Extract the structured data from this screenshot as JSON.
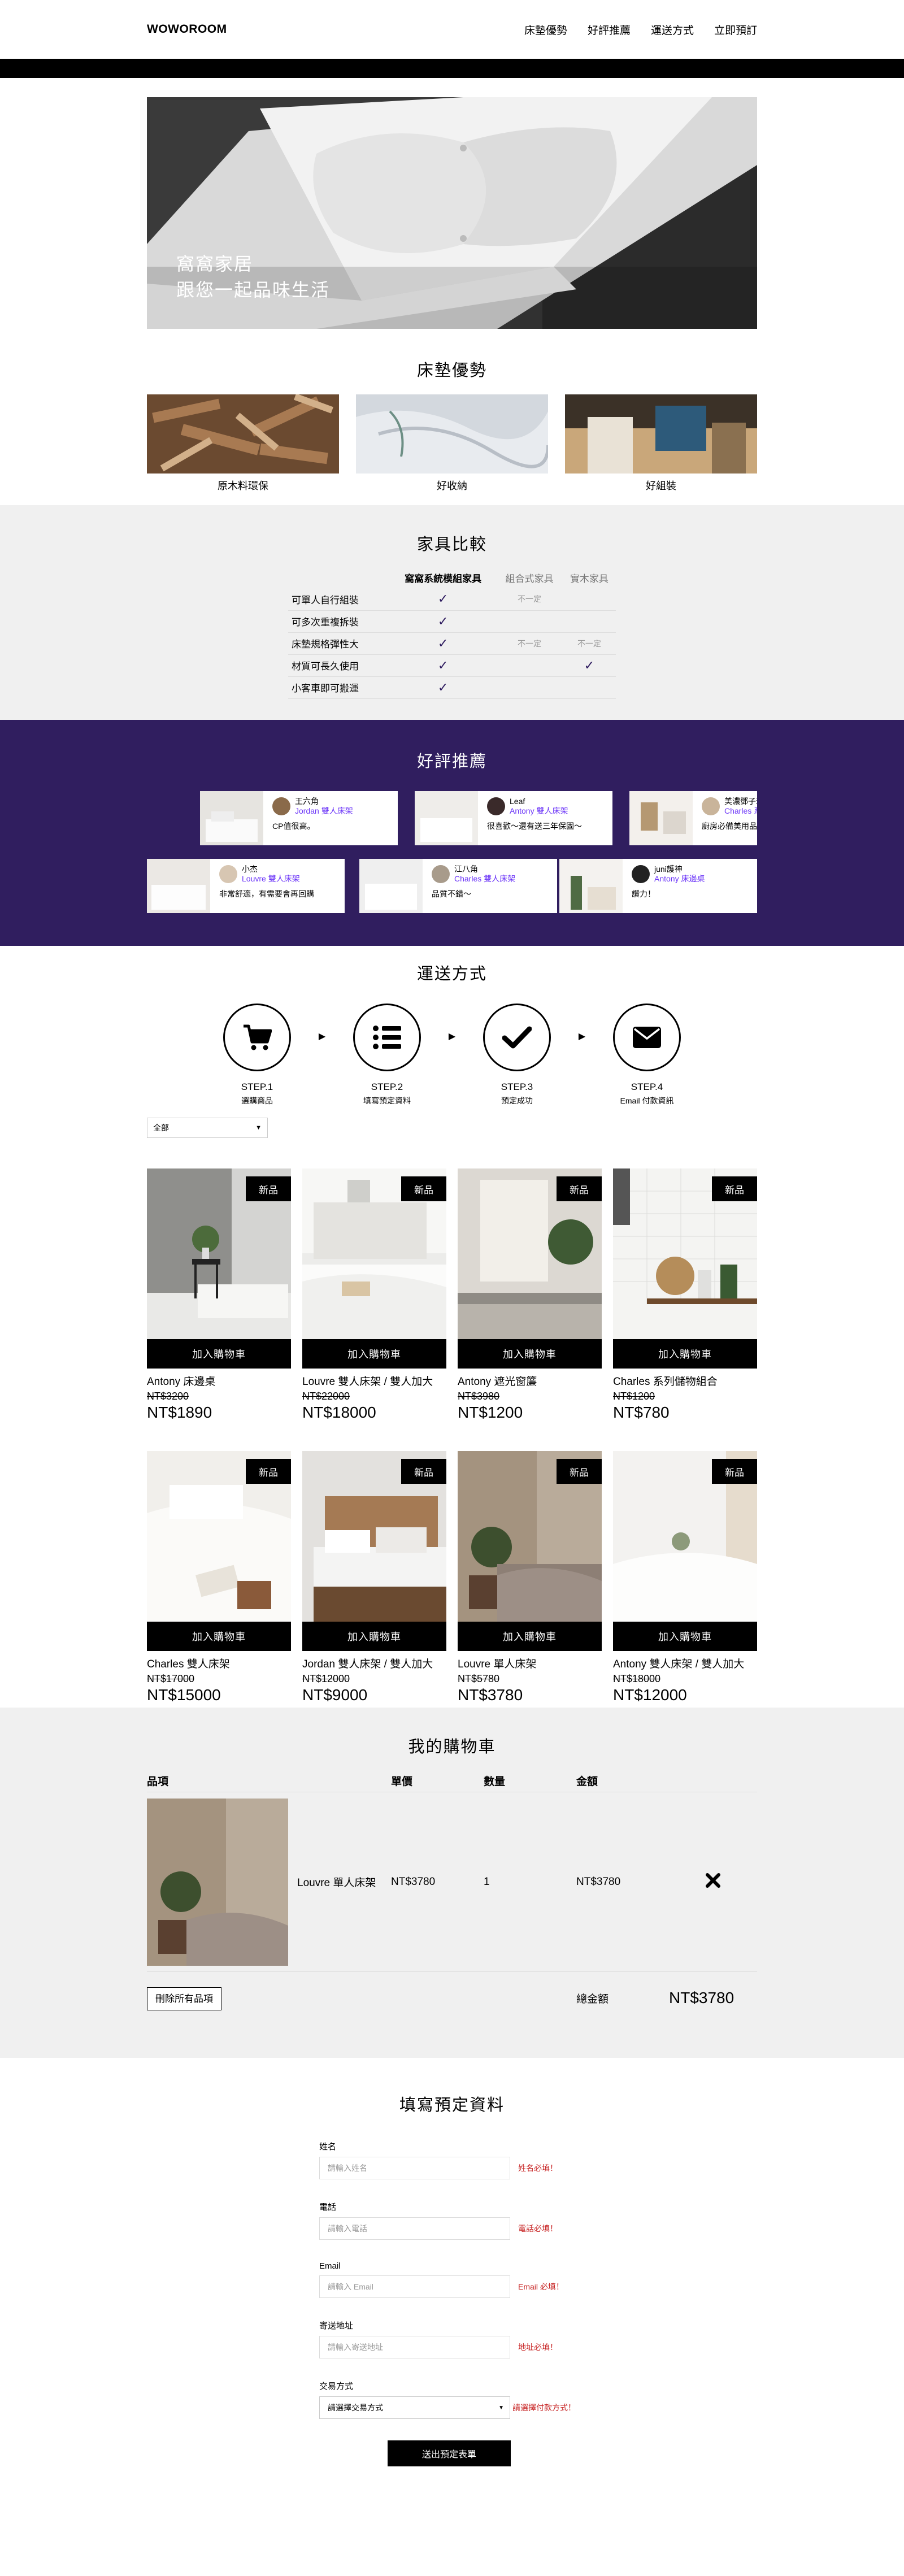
{
  "header": {
    "logo": "WOWOROOM",
    "nav": [
      "床墊優勢",
      "好評推薦",
      "運送方式",
      "立即預訂"
    ]
  },
  "hero": {
    "line1": "窩窩家居",
    "line2": "跟您一起品味生活"
  },
  "advantages": {
    "title": "床墊優勢",
    "items": [
      "原木料環保",
      "好收納",
      "好組裝"
    ]
  },
  "compare": {
    "title": "家具比較",
    "columns": [
      "窩窩系統模組家具",
      "組合式家具",
      "實木家具"
    ],
    "rows": [
      {
        "label": "可單人自行組裝",
        "c1": "✓",
        "c2": "不一定",
        "c3": ""
      },
      {
        "label": "可多次重複拆裝",
        "c1": "✓",
        "c2": "",
        "c3": ""
      },
      {
        "label": "床墊規格彈性大",
        "c1": "✓",
        "c2": "不一定",
        "c3": "不一定"
      },
      {
        "label": "材質可長久使用",
        "c1": "✓",
        "c2": "",
        "c3": "✓"
      },
      {
        "label": "小客車即可搬運",
        "c1": "✓",
        "c2": "",
        "c3": ""
      }
    ]
  },
  "reviews": {
    "title": "好評推薦",
    "items": [
      {
        "name": "王六角",
        "product": "Jordan 雙人床架",
        "text": "CP值很高。"
      },
      {
        "name": "Leaf",
        "product": "Antony 雙人床架",
        "text": "很喜歡～還有送三年保固～"
      },
      {
        "name": "美濃鄧子琪",
        "product": "Charles 系",
        "text": "廚房必備美用品！"
      },
      {
        "name": "小杰",
        "product": "Louvre 雙人床架",
        "text": "非常舒適，有需要會再回購"
      },
      {
        "name": "江八角",
        "product": "Charles 雙人床架",
        "text": "品質不錯～"
      },
      {
        "name": "juni護神",
        "product": "Antony 床邊桌",
        "text": "讚力！"
      }
    ]
  },
  "shipping": {
    "title": "運送方式",
    "steps": [
      {
        "title": "STEP.1",
        "desc": "選購商品",
        "icon": "cart-icon"
      },
      {
        "title": "STEP.2",
        "desc": "填寫預定資料",
        "icon": "list-icon"
      },
      {
        "title": "STEP.3",
        "desc": "預定成功",
        "icon": "check-icon"
      },
      {
        "title": "STEP.4",
        "desc": "Email 付款資訊",
        "icon": "envelope-icon"
      }
    ]
  },
  "products": {
    "filter": "全部",
    "badge": "新品",
    "add_label": "加入購物車",
    "items": [
      {
        "name": "Antony 床邊桌",
        "old": "NT$3200",
        "price": "NT$1890"
      },
      {
        "name": "Louvre 雙人床架 / 雙人加大",
        "old": "NT$22000",
        "price": "NT$18000"
      },
      {
        "name": "Antony 遮光窗簾",
        "old": "NT$3980",
        "price": "NT$1200"
      },
      {
        "name": "Charles 系列儲物組合",
        "old": "NT$1200",
        "price": "NT$780"
      },
      {
        "name": "Charles 雙人床架",
        "old": "NT$17000",
        "price": "NT$15000"
      },
      {
        "name": "Jordan 雙人床架 / 雙人加大",
        "old": "NT$12000",
        "price": "NT$9000"
      },
      {
        "name": "Louvre 單人床架",
        "old": "NT$5780",
        "price": "NT$3780"
      },
      {
        "name": "Antony 雙人床架 / 雙人加大",
        "old": "NT$18000",
        "price": "NT$12000"
      }
    ]
  },
  "cart": {
    "title": "我的購物車",
    "headers": [
      "品項",
      "單價",
      "數量",
      "金額"
    ],
    "item": {
      "name": "Louvre 單人床架",
      "price": "NT$3780",
      "qty": "1",
      "total": "NT$3780"
    },
    "delete_all": "刪除所有品項",
    "total_label": "總金額",
    "total": "NT$3780"
  },
  "order": {
    "title": "填寫預定資料",
    "fields": [
      {
        "label": "姓名",
        "placeholder": "請輸入姓名",
        "error": "姓名必填！"
      },
      {
        "label": "電話",
        "placeholder": "請輸入電話",
        "error": "電話必填！"
      },
      {
        "label": "Email",
        "placeholder": "請輸入 Email",
        "error": "Email 必填！"
      },
      {
        "label": "寄送地址",
        "placeholder": "請輸入寄送地址",
        "error": "地址必填！"
      }
    ],
    "payment": {
      "label": "交易方式",
      "value": "請選擇交易方式",
      "error": "請選擇付款方式！"
    },
    "submit": "送出預定表單"
  },
  "colors": {
    "purple": "#301e5f",
    "accent": "#6a33f8",
    "error": "#c72424"
  }
}
